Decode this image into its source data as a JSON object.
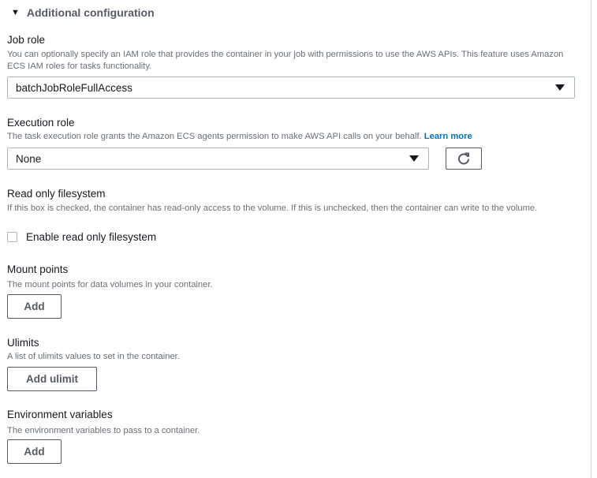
{
  "section": {
    "title": "Additional configuration",
    "expanded": true
  },
  "job_role": {
    "label": "Job role",
    "description": "You can optionally specify an IAM role that provides the container in your job with permissions to use the AWS APIs. This feature uses Amazon ECS IAM roles for tasks functionality.",
    "selected": "batchJobRoleFullAccess"
  },
  "execution_role": {
    "label": "Execution role",
    "description": "The task execution role grants the Amazon ECS agents permission to make AWS API calls on your behalf.",
    "learn_more": "Learn more",
    "selected": "None",
    "refresh_icon": "refresh-icon"
  },
  "read_only_fs": {
    "label": "Read only filesystem",
    "description": "If this box is checked, the container has read-only access to the volume. If this is unchecked, then the container can write to the volume.",
    "checkbox_label": "Enable read only filesystem",
    "checked": false
  },
  "mount_points": {
    "label": "Mount points",
    "description": "The mount points for data volumes in your container.",
    "button": "Add"
  },
  "ulimits": {
    "label": "Ulimits",
    "description": "A list of ulimits values to set in the container.",
    "button": "Add ulimit"
  },
  "env_vars": {
    "label": "Environment variables",
    "description": "The environment variables to pass to a container.",
    "button": "Add"
  },
  "colors": {
    "link": "#0073bb",
    "text": "#16191f",
    "muted": "#687078",
    "border": "#aab7b8"
  }
}
